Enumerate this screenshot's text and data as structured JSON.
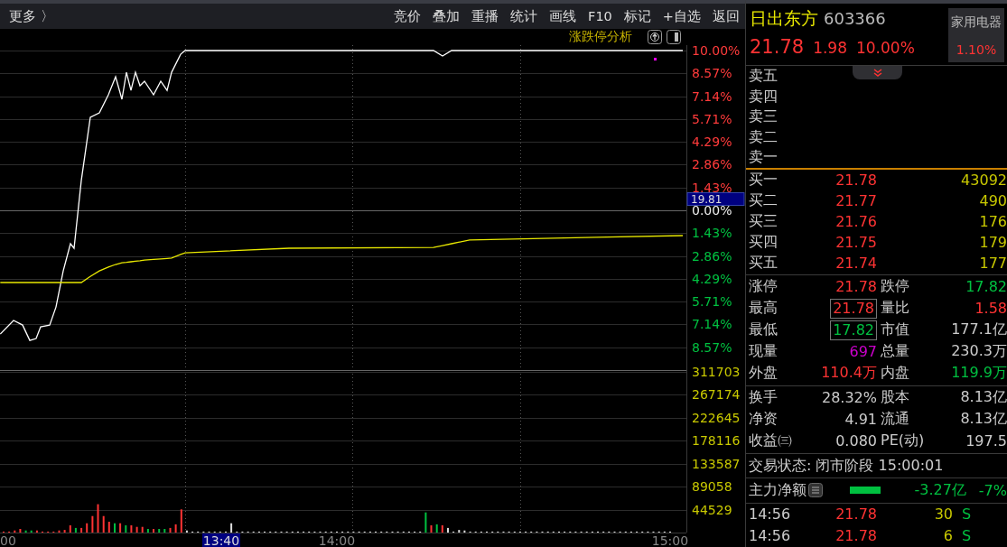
{
  "toolbar": {
    "more": "更多 〉",
    "items": [
      "竞价",
      "叠加",
      "重播",
      "统计",
      "画线",
      "F10",
      "标记",
      "+自选",
      "返回"
    ]
  },
  "chart_header": {
    "title": "涨跌停分析"
  },
  "price_chart": {
    "cursor_price": "19.81",
    "chart_data": {
      "type": "line",
      "grid": true,
      "xlim": [
        779.35,
        902.93
      ],
      "ylim": [
        -10,
        10.34
      ],
      "x": [
        779.4,
        781.79,
        783.41,
        784.72,
        785.85,
        786.67,
        788.29,
        789.43,
        790.73,
        792.03,
        792.68,
        793.98,
        795.61,
        797.24,
        798.86,
        800.16,
        801.3,
        802.11,
        802.93,
        803.74,
        804.55,
        805.37,
        806.99,
        808.29,
        809.43,
        810.24,
        811.87,
        812.68,
        831.38,
        857.4,
        859.02,
        860.65,
        863.9,
        886.67,
        902.28
      ],
      "yticks": [
        {
          "value": 10,
          "label": "10.00%"
        },
        {
          "value": 8.57,
          "label": "8.57%"
        },
        {
          "value": 7.14,
          "label": "7.14%"
        },
        {
          "value": 5.71,
          "label": "5.71%"
        },
        {
          "value": 4.29,
          "label": "4.29%"
        },
        {
          "value": 2.86,
          "label": "2.86%"
        },
        {
          "value": 1.43,
          "label": "1.43%"
        },
        {
          "value": 0,
          "label": "0.00%"
        },
        {
          "value": -1.43,
          "label": "1.43%"
        },
        {
          "value": -2.86,
          "label": "2.86%"
        },
        {
          "value": -4.29,
          "label": "4.29%"
        },
        {
          "value": -5.71,
          "label": "5.71%"
        },
        {
          "value": -7.14,
          "label": "7.14%"
        },
        {
          "value": -8.57,
          "label": "8.57%"
        }
      ],
      "series": [
        {
          "color": "#ffffff",
          "values": [
            -7.74,
            -6.89,
            -7.18,
            -8.14,
            -8.02,
            -7.29,
            -7.18,
            -6.05,
            -3.79,
            -2.09,
            -2.37,
            1.86,
            5.82,
            6.1,
            7.23,
            8.36,
            6.95,
            8.64,
            7.51,
            8.64,
            7.8,
            8.08,
            7.23,
            8.08,
            7.51,
            8.64,
            9.77,
            10,
            10,
            10,
            9.66,
            10,
            10,
            10,
            10
          ]
        },
        {
          "color": "#e8e800",
          "values": [
            -4.52,
            -4.52,
            -4.52,
            -4.52,
            -4.52,
            -4.52,
            -4.52,
            -4.52,
            -4.52,
            -4.52,
            -4.52,
            -4.52,
            -4.14,
            -3.79,
            -3.55,
            -3.39,
            -3.29,
            -3.26,
            -3.22,
            -3.18,
            -3.15,
            -3.11,
            -3.07,
            -3.04,
            -3.01,
            -2.99,
            -2.76,
            -2.66,
            -2.37,
            -2.32,
            -2.21,
            -2.09,
            -1.86,
            -1.69,
            -1.58
          ]
        }
      ]
    }
  },
  "volume_chart": {
    "cursor_time": "13:40",
    "first_time_label": "00",
    "chart_data": {
      "type": "bar",
      "stacked": true,
      "grid": true,
      "xlim": [
        779.35,
        902.93
      ],
      "ylim": [
        0,
        315000
      ],
      "x": [
        780,
        781,
        782,
        783,
        784,
        785,
        786,
        787,
        788,
        789,
        790,
        791,
        792,
        793,
        794,
        795,
        796,
        797,
        798,
        799,
        800,
        801,
        802,
        803,
        804,
        805,
        806,
        807,
        808,
        809,
        810,
        811,
        812,
        813,
        814,
        815,
        816,
        817,
        818,
        819,
        820,
        821,
        822,
        823,
        824,
        825,
        826,
        827,
        828,
        829,
        830,
        831,
        832,
        833,
        834,
        835,
        836,
        837,
        838,
        839,
        840,
        841,
        842,
        843,
        844,
        845,
        846,
        847,
        848,
        849,
        850,
        851,
        852,
        853,
        854,
        855,
        856,
        857,
        858,
        859,
        860,
        861,
        862,
        863,
        864,
        865,
        866,
        867,
        868,
        869,
        870,
        871,
        872,
        873,
        874,
        875,
        876,
        877,
        878,
        879,
        880,
        881,
        882,
        883,
        884,
        885,
        886,
        887,
        888,
        889,
        890,
        891,
        892,
        893,
        894,
        895,
        896,
        897,
        898,
        899,
        900
      ],
      "xticks": [
        {
          "value": 840,
          "label": "14:00"
        },
        {
          "value": 900,
          "label": "15:00"
        }
      ],
      "yticks": [
        44529,
        89058,
        133587,
        178116,
        222645,
        267174,
        311703
      ],
      "series": [
        {
          "color": "#ff3333",
          "values": [
            2000,
            2000,
            4000,
            7000,
            null,
            null,
            4000,
            2000,
            2000,
            2000,
            4000,
            5000,
            14000,
            null,
            9000,
            18000,
            32000,
            55000,
            32000,
            21000,
            null,
            18000,
            null,
            14000,
            11000,
            11000,
            null,
            7000,
            null,
            null,
            9000,
            16000,
            45000,
            null,
            null,
            null,
            null,
            null,
            null,
            null,
            null,
            null,
            null,
            null,
            null,
            null,
            null,
            null,
            null,
            null,
            null,
            null,
            null,
            null,
            null,
            null,
            null,
            null,
            null,
            null,
            null,
            null,
            null,
            null,
            null,
            null,
            null,
            null,
            null,
            null,
            null,
            null,
            null,
            null,
            null,
            null,
            null,
            14000,
            null,
            14000,
            null,
            null,
            null,
            null,
            null,
            null,
            null,
            null,
            null,
            null,
            null,
            null,
            null,
            null,
            null,
            null,
            null,
            null,
            null,
            null,
            null,
            null,
            null,
            null,
            null,
            null,
            null,
            null,
            null,
            null,
            null,
            null,
            null,
            null,
            null,
            null,
            null,
            null,
            null,
            null,
            null
          ]
        },
        {
          "color": "#00c040",
          "values": [
            null,
            null,
            null,
            null,
            4000,
            4000,
            null,
            null,
            null,
            null,
            null,
            null,
            null,
            9000,
            null,
            null,
            null,
            null,
            null,
            null,
            18000,
            null,
            14000,
            null,
            null,
            null,
            7000,
            null,
            7000,
            7000,
            null,
            null,
            null,
            null,
            null,
            null,
            null,
            null,
            null,
            null,
            null,
            null,
            null,
            null,
            null,
            null,
            null,
            null,
            null,
            null,
            null,
            null,
            null,
            null,
            null,
            null,
            null,
            null,
            null,
            null,
            null,
            null,
            null,
            null,
            null,
            null,
            null,
            null,
            null,
            null,
            null,
            null,
            null,
            null,
            null,
            null,
            39000,
            null,
            16000,
            null,
            null,
            null,
            null,
            null,
            null,
            null,
            null,
            null,
            null,
            null,
            null,
            null,
            null,
            null,
            null,
            null,
            null,
            null,
            null,
            null,
            null,
            null,
            null,
            null,
            null,
            null,
            null,
            null,
            null,
            null,
            null,
            null,
            null,
            null,
            null,
            null,
            null,
            null,
            null,
            null,
            null
          ]
        },
        {
          "color": "#dddddd",
          "values": [
            null,
            null,
            null,
            null,
            null,
            null,
            null,
            null,
            null,
            null,
            null,
            null,
            null,
            null,
            null,
            null,
            null,
            null,
            null,
            null,
            null,
            null,
            null,
            null,
            null,
            null,
            null,
            null,
            null,
            null,
            null,
            null,
            null,
            4000,
            2000,
            2000,
            2000,
            2000,
            2000,
            2000,
            2000,
            18000,
            2000,
            2000,
            2000,
            2000,
            2000,
            2000,
            2000,
            2000,
            2000,
            2000,
            2000,
            2000,
            2000,
            2000,
            2000,
            2000,
            2000,
            2000,
            2000,
            2000,
            2000,
            2000,
            2000,
            2000,
            2000,
            2000,
            2000,
            2000,
            2000,
            2000,
            2000,
            2000,
            2000,
            2000,
            null,
            null,
            null,
            null,
            9000,
            2000,
            5000,
            4000,
            2000,
            2000,
            2000,
            2000,
            2000,
            2000,
            2000,
            2000,
            2000,
            2000,
            2000,
            2000,
            2000,
            2000,
            2000,
            2000,
            2000,
            2000,
            2000,
            2000,
            2000,
            2000,
            2000,
            2000,
            2000,
            2000,
            2000,
            2000,
            2000,
            2000,
            2000,
            2000,
            2000,
            2000,
            2000,
            2000,
            2000
          ]
        }
      ]
    }
  },
  "quote": {
    "name": "日出东方",
    "code": "603366",
    "price": "21.78",
    "change": "1.98",
    "change_pct": "10.00%",
    "sector": {
      "name": "家用电器",
      "change_pct": "1.10%"
    }
  },
  "order_book": {
    "sell": [
      "卖五",
      "卖四",
      "卖三",
      "卖二",
      "卖一"
    ],
    "buy": [
      {
        "label": "买一",
        "price": "21.78",
        "volume": "43092"
      },
      {
        "label": "买二",
        "price": "21.77",
        "volume": "490"
      },
      {
        "label": "买三",
        "price": "21.76",
        "volume": "176"
      },
      {
        "label": "买四",
        "price": "21.75",
        "volume": "179"
      },
      {
        "label": "买五",
        "price": "21.74",
        "volume": "177"
      }
    ]
  },
  "stats": [
    {
      "label": "涨停",
      "value": "21.78",
      "color": "#ff3333",
      "highlighted": false
    },
    {
      "label": "跌停",
      "value": "17.82",
      "color": "#00c040",
      "highlighted": false
    },
    {
      "label": "最高",
      "value": "21.78",
      "color": "#ff3333",
      "highlighted": true
    },
    {
      "label": "量比",
      "value": "1.58",
      "color": "#ff3333",
      "highlighted": false
    },
    {
      "label": "最低",
      "value": "17.82",
      "color": "#00c040",
      "highlighted": true
    },
    {
      "label": "市值",
      "value": "177.1亿",
      "color": "#cccccc",
      "highlighted": false
    },
    {
      "label": "现量",
      "value": "697",
      "color": "#cc00cc",
      "highlighted": false
    },
    {
      "label": "总量",
      "value": "230.3万",
      "color": "#cccccc",
      "highlighted": false
    },
    {
      "label": "外盘",
      "value": "110.4万",
      "color": "#ff3333",
      "highlighted": false
    },
    {
      "label": "内盘",
      "value": "119.9万",
      "color": "#00c040",
      "highlighted": false
    }
  ],
  "fundamentals": [
    {
      "label": "换手",
      "value": "28.32%"
    },
    {
      "label": "股本",
      "value": "8.13亿"
    },
    {
      "label": "净资",
      "value": "4.91"
    },
    {
      "label": "流通",
      "value": "8.13亿"
    },
    {
      "label": "收益㈢",
      "value": "0.080"
    },
    {
      "label": "PE(动)",
      "value": "197.5"
    }
  ],
  "trade_status": "交易状态: 闭市阶段 15:00:01",
  "main_flow": {
    "label": "主力净额",
    "amount": "-3.27亿",
    "pct": "-7%"
  },
  "ticks": [
    {
      "time": "14:56",
      "price": "21.78",
      "volume": "30",
      "side": "S"
    },
    {
      "time": "14:56",
      "price": "21.78",
      "volume": "6",
      "side": "S"
    }
  ]
}
